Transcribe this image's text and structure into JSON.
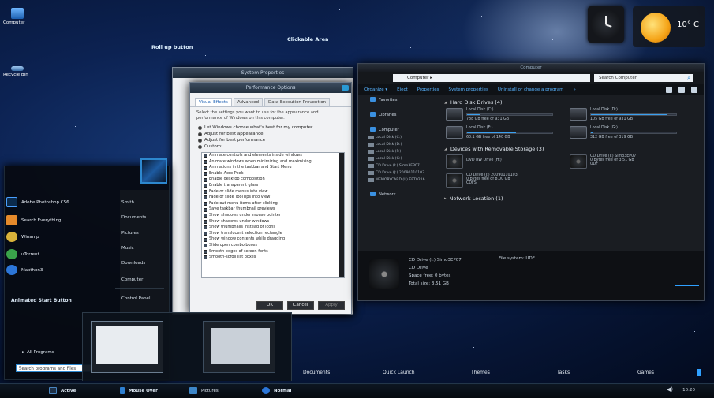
{
  "desktop": {
    "icons": [
      {
        "label": "Computer"
      },
      {
        "label": "Recycle Bin"
      }
    ],
    "callouts": {
      "rollup": "Roll up button",
      "clickable": "Clickable Area"
    }
  },
  "weather": {
    "temp": "10° C"
  },
  "system_properties": {
    "title": "System Properties"
  },
  "performance_options": {
    "title": "Performance Options",
    "tabs": [
      "Visual Effects",
      "Advanced",
      "Data Execution Prevention"
    ],
    "intro": "Select the settings you want to use for the appearance and performance of Windows on this computer.",
    "radios": [
      "Let Windows choose what's best for my computer",
      "Adjust for best appearance",
      "Adjust for best performance",
      "Custom:"
    ],
    "checklist": [
      "Animate controls and elements inside windows",
      "Animate windows when minimizing and maximizing",
      "Animations in the taskbar and Start Menu",
      "Enable Aero Peek",
      "Enable desktop composition",
      "Enable transparent glass",
      "Fade or slide menus into view",
      "Fade or slide ToolTips into view",
      "Fade out menu items after clicking",
      "Save taskbar thumbnail previews",
      "Show shadows under mouse pointer",
      "Show shadows under windows",
      "Show thumbnails instead of icons",
      "Show translucent selection rectangle",
      "Show window contents while dragging",
      "Slide open combo boxes",
      "Smooth edges of screen fonts",
      "Smooth-scroll list boxes"
    ],
    "buttons": {
      "ok": "OK",
      "cancel": "Cancel",
      "apply": "Apply"
    }
  },
  "explorer": {
    "title": "Computer",
    "address": "Computer ▸",
    "search_placeholder": "Search Computer",
    "toolbar": [
      "Organize ▾",
      "Eject",
      "Properties",
      "System properties",
      "Uninstall or change a program",
      "»"
    ],
    "nav": {
      "favorites": "Favorites",
      "libraries": "Libraries",
      "computer": "Computer",
      "subitems": [
        "Local Disk (C:)",
        "Local Disk (D:)",
        "Local Disk (F:)",
        "Local Disk (G:)",
        "CD Drive (I:) Simo3EP07",
        "CD Drive (J:) 20090110103",
        "MEMORYCARD (I:) EPT0216"
      ],
      "network": "Network"
    },
    "groups": {
      "hdd": "Hard Disk Drives (4)",
      "removable": "Devices with Removable Storage (3)",
      "network": "Network Location (1)"
    },
    "hard_drives": [
      {
        "name": "Local Disk (C:)",
        "free": "788 GB free of 931 GB",
        "used_pct": 15
      },
      {
        "name": "Local Disk (D:)",
        "free": "105 GB free of 931 GB",
        "used_pct": 89
      },
      {
        "name": "Local Disk (F:)",
        "free": "60.1 GB free of 140 GB",
        "used_pct": 57
      },
      {
        "name": "Local Disk (G:)",
        "free": "312 GB free of 319 GB",
        "used_pct": 2
      }
    ],
    "removable": [
      {
        "name": "DVD RW Drive (H:)",
        "info": ""
      },
      {
        "name": "CD Drive (I:) Simo3EP07",
        "info": "0 bytes free of 3.51 GB",
        "extra": "UDF"
      },
      {
        "name": "CD Drive (J:) 20090110103",
        "info": "0 bytes free of 8.00 GB",
        "extra": "CDFS"
      }
    ],
    "details": {
      "line1": "CD Drive (I:) Simo3EP07",
      "line2": "CD Drive",
      "line3": "Space free: 0 bytes",
      "line4": "Total size: 3.51 GB",
      "fs": "File system: UDF"
    }
  },
  "start_menu": {
    "programs": [
      "Adobe Photoshop CS6",
      "Search Everything",
      "Winamp",
      "uTorrent",
      "Maxthon3"
    ],
    "right_items": [
      "Smith",
      "Documents",
      "Pictures",
      "Music",
      "Downloads",
      "Computer",
      "Control Panel"
    ],
    "animated_label": "Animated Start Button",
    "all_programs": "►  All Programs",
    "search_placeholder": "Search programs and files"
  },
  "bottom_strip": {
    "items": [
      "Documents",
      "Quick Launch",
      "Themes",
      "Tasks",
      "Games"
    ]
  },
  "taskbar": {
    "items": [
      {
        "label": "Active"
      },
      {
        "label": "Mouse Over"
      },
      {
        "label": "Pictures"
      },
      {
        "label": "Normal"
      }
    ],
    "time": "10:20"
  }
}
